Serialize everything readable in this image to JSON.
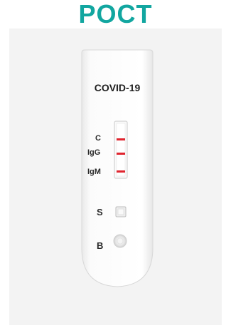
{
  "header": {
    "title": "POCT"
  },
  "device": {
    "test_name": "COVID-19",
    "line_labels": {
      "control": "C",
      "igg": "IgG",
      "igm": "IgM"
    },
    "well_labels": {
      "sample": "S",
      "buffer": "B"
    },
    "colors": {
      "title": "#12a6a0",
      "line": "#e0252f",
      "strip": "#ffffff",
      "background": "#f3f3f3"
    }
  }
}
